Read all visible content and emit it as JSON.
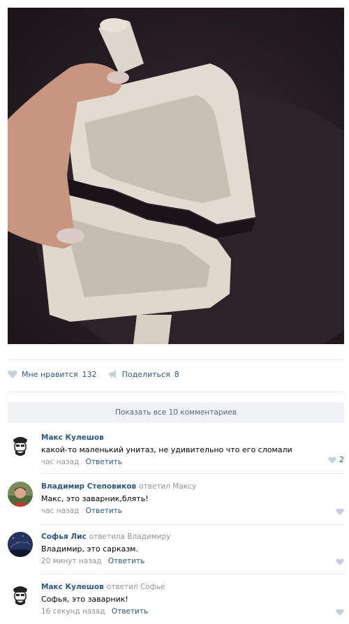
{
  "post": {
    "actions": {
      "like_label": "Мне нравится",
      "like_count": "132",
      "share_label": "Поделиться",
      "share_count": "8"
    },
    "show_all_comments": "Показать все 10 комментариев"
  },
  "comments": [
    {
      "author": "Макс Кулешов",
      "replied": "",
      "text": "какой-то маленький унитаз, не удивительно что его сломали",
      "time": "час назад",
      "reply_label": "Ответить",
      "likes": "2"
    },
    {
      "author": "Владимир Степовиков",
      "replied": "ответил Максу",
      "text": "Макс, это заварник,блять!",
      "time": "час назад",
      "reply_label": "Ответить",
      "likes": ""
    },
    {
      "author": "Софья Лис",
      "replied": "ответила Владимиру",
      "text": "Владимир, это сарказм.",
      "time": "20 минут назад",
      "reply_label": "Ответить",
      "likes": ""
    },
    {
      "author": "Макс Кулешов",
      "replied": "ответил Софье",
      "text": "Софья, это заварник!",
      "time": "16 секунд назад",
      "reply_label": "Ответить",
      "likes": ""
    }
  ],
  "icons": {
    "like": "heart-icon",
    "share": "megaphone-icon"
  },
  "colors": {
    "link": "#2a5885",
    "muted": "#939393",
    "like_icon": "#c5d0db",
    "show_all_bg": "#f0f2f5"
  }
}
